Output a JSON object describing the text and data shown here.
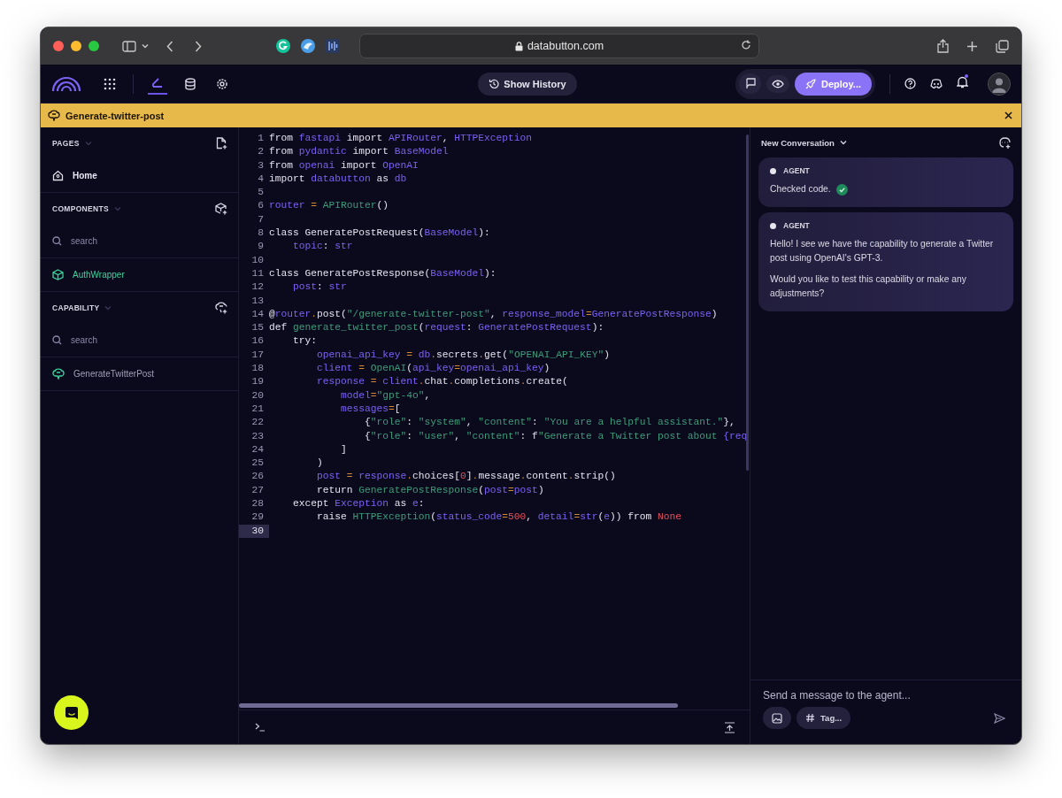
{
  "browser": {
    "url": "databutton.com"
  },
  "toolbar": {
    "nav_items": [
      {
        "kind": "apps",
        "selected": false
      },
      {
        "kind": "editor",
        "selected": true
      },
      {
        "kind": "database",
        "selected": false
      },
      {
        "kind": "settings",
        "selected": false
      }
    ],
    "history_button": "Show History",
    "deploy_button": "Deploy...",
    "notifications_unread": true
  },
  "banner": {
    "title": "Generate-twitter-post"
  },
  "sidebar": {
    "sections": [
      {
        "title": "PAGES",
        "kind": "pages",
        "items": [
          {
            "label": "Home",
            "kind": "page"
          }
        ]
      },
      {
        "title": "COMPONENTS",
        "kind": "components",
        "search_placeholder": "search",
        "items": [
          {
            "label": "AuthWrapper",
            "kind": "component"
          }
        ]
      },
      {
        "title": "CAPABILITY",
        "kind": "capability",
        "search_placeholder": "search",
        "items": [
          {
            "label": "GenerateTwitterPost",
            "kind": "capability"
          }
        ]
      }
    ]
  },
  "editor": {
    "lines": [
      {
        "n": "1",
        "selected": false,
        "t": [
          {
            "kind": "plain",
            "text": "from "
          },
          {
            "kind": "name",
            "text": "fastapi"
          },
          {
            "kind": "plain",
            "text": " import "
          },
          {
            "kind": "name",
            "text": "APIRouter"
          },
          {
            "kind": "plain",
            "text": ", "
          },
          {
            "kind": "name",
            "text": "HTTPException"
          }
        ]
      },
      {
        "n": "2",
        "selected": false,
        "t": [
          {
            "kind": "plain",
            "text": "from "
          },
          {
            "kind": "name",
            "text": "pydantic"
          },
          {
            "kind": "plain",
            "text": " import "
          },
          {
            "kind": "name",
            "text": "BaseModel"
          }
        ]
      },
      {
        "n": "3",
        "selected": false,
        "t": [
          {
            "kind": "plain",
            "text": "from "
          },
          {
            "kind": "name",
            "text": "openai"
          },
          {
            "kind": "plain",
            "text": " import "
          },
          {
            "kind": "name",
            "text": "OpenAI"
          }
        ]
      },
      {
        "n": "4",
        "selected": false,
        "t": [
          {
            "kind": "plain",
            "text": "import "
          },
          {
            "kind": "name",
            "text": "databutton"
          },
          {
            "kind": "plain",
            "text": " as "
          },
          {
            "kind": "name",
            "text": "db"
          }
        ]
      },
      {
        "n": "5",
        "selected": false
      },
      {
        "n": "6",
        "selected": false,
        "t": [
          {
            "kind": "name",
            "text": "router"
          },
          {
            "kind": "operator",
            "text": " = "
          },
          {
            "kind": "call",
            "text": "APIRouter"
          },
          {
            "kind": "plain",
            "text": "()"
          }
        ]
      },
      {
        "n": "7",
        "selected": false
      },
      {
        "n": "8",
        "selected": false,
        "t": [
          {
            "kind": "plain",
            "text": "class GeneratePostRequest("
          },
          {
            "kind": "name",
            "text": "BaseModel"
          },
          {
            "kind": "plain",
            "text": "):"
          }
        ]
      },
      {
        "n": "9",
        "selected": false,
        "t": [
          {
            "kind": "name",
            "text": "    topic"
          },
          {
            "kind": "plain",
            "text": ": "
          },
          {
            "kind": "name",
            "text": "str"
          }
        ]
      },
      {
        "n": "10",
        "selected": false
      },
      {
        "n": "11",
        "selected": false,
        "t": [
          {
            "kind": "plain",
            "text": "class GeneratePostResponse("
          },
          {
            "kind": "name",
            "text": "BaseModel"
          },
          {
            "kind": "plain",
            "text": "):"
          }
        ]
      },
      {
        "n": "12",
        "selected": false,
        "t": [
          {
            "kind": "name",
            "text": "    post"
          },
          {
            "kind": "plain",
            "text": ": "
          },
          {
            "kind": "name",
            "text": "str"
          }
        ]
      },
      {
        "n": "13",
        "selected": false
      },
      {
        "n": "14",
        "selected": false,
        "t": [
          {
            "kind": "plain",
            "text": "@"
          },
          {
            "kind": "name",
            "text": "router"
          },
          {
            "kind": "operator",
            "text": "."
          },
          {
            "kind": "plain",
            "text": "post("
          },
          {
            "kind": "string",
            "text": "\"/generate-twitter-post\""
          },
          {
            "kind": "plain",
            "text": ", "
          },
          {
            "kind": "name",
            "text": "response_model"
          },
          {
            "kind": "operator",
            "text": "="
          },
          {
            "kind": "name",
            "text": "GeneratePostResponse"
          },
          {
            "kind": "plain",
            "text": ")"
          }
        ]
      },
      {
        "n": "15",
        "selected": false,
        "t": [
          {
            "kind": "plain",
            "text": "def "
          },
          {
            "kind": "call",
            "text": "generate_twitter_post"
          },
          {
            "kind": "plain",
            "text": "("
          },
          {
            "kind": "name",
            "text": "request"
          },
          {
            "kind": "plain",
            "text": ": "
          },
          {
            "kind": "name",
            "text": "GeneratePostRequest"
          },
          {
            "kind": "plain",
            "text": "):"
          }
        ]
      },
      {
        "n": "16",
        "selected": false,
        "t": [
          {
            "kind": "plain",
            "text": "    try:"
          }
        ]
      },
      {
        "n": "17",
        "selected": false,
        "t": [
          {
            "kind": "name",
            "text": "        openai_api_key"
          },
          {
            "kind": "operator",
            "text": " = "
          },
          {
            "kind": "name",
            "text": "db"
          },
          {
            "kind": "operator",
            "text": "."
          },
          {
            "kind": "plain",
            "text": "secrets"
          },
          {
            "kind": "operator",
            "text": "."
          },
          {
            "kind": "plain",
            "text": "get("
          },
          {
            "kind": "string",
            "text": "\"OPENAI_API_KEY\""
          },
          {
            "kind": "plain",
            "text": ")"
          }
        ]
      },
      {
        "n": "18",
        "selected": false,
        "t": [
          {
            "kind": "name",
            "text": "        client"
          },
          {
            "kind": "operator",
            "text": " = "
          },
          {
            "kind": "call",
            "text": "OpenAI"
          },
          {
            "kind": "plain",
            "text": "("
          },
          {
            "kind": "name",
            "text": "api_key"
          },
          {
            "kind": "operator",
            "text": "="
          },
          {
            "kind": "name",
            "text": "openai_api_key"
          },
          {
            "kind": "plain",
            "text": ")"
          }
        ]
      },
      {
        "n": "19",
        "selected": false,
        "t": [
          {
            "kind": "name",
            "text": "        response"
          },
          {
            "kind": "operator",
            "text": " = "
          },
          {
            "kind": "name",
            "text": "client"
          },
          {
            "kind": "operator",
            "text": "."
          },
          {
            "kind": "plain",
            "text": "chat"
          },
          {
            "kind": "operator",
            "text": "."
          },
          {
            "kind": "plain",
            "text": "completions"
          },
          {
            "kind": "operator",
            "text": "."
          },
          {
            "kind": "plain",
            "text": "create("
          }
        ]
      },
      {
        "n": "20",
        "selected": false,
        "t": [
          {
            "kind": "name",
            "text": "            model"
          },
          {
            "kind": "operator",
            "text": "="
          },
          {
            "kind": "string",
            "text": "\"gpt-4o\""
          },
          {
            "kind": "plain",
            "text": ","
          }
        ]
      },
      {
        "n": "21",
        "selected": false,
        "t": [
          {
            "kind": "name",
            "text": "            messages"
          },
          {
            "kind": "operator",
            "text": "="
          },
          {
            "kind": "plain",
            "text": "["
          }
        ]
      },
      {
        "n": "22",
        "selected": false,
        "t": [
          {
            "kind": "plain",
            "text": "                {"
          },
          {
            "kind": "string",
            "text": "\"role\""
          },
          {
            "kind": "plain",
            "text": ": "
          },
          {
            "kind": "string",
            "text": "\"system\""
          },
          {
            "kind": "plain",
            "text": ", "
          },
          {
            "kind": "string",
            "text": "\"content\""
          },
          {
            "kind": "plain",
            "text": ": "
          },
          {
            "kind": "string",
            "text": "\"You are a helpful assistant.\""
          },
          {
            "kind": "plain",
            "text": "},"
          }
        ]
      },
      {
        "n": "23",
        "selected": false,
        "t": [
          {
            "kind": "plain",
            "text": "                {"
          },
          {
            "kind": "string",
            "text": "\"role\""
          },
          {
            "kind": "plain",
            "text": ": "
          },
          {
            "kind": "string",
            "text": "\"user\""
          },
          {
            "kind": "plain",
            "text": ", "
          },
          {
            "kind": "string",
            "text": "\"content\""
          },
          {
            "kind": "plain",
            "text": ": f"
          },
          {
            "kind": "string",
            "text": "\"Generate a Twitter post about "
          },
          {
            "kind": "name",
            "text": "{req"
          }
        ]
      },
      {
        "n": "24",
        "selected": false,
        "t": [
          {
            "kind": "plain",
            "text": "            ]"
          }
        ]
      },
      {
        "n": "25",
        "selected": false,
        "t": [
          {
            "kind": "plain",
            "text": "        )"
          }
        ]
      },
      {
        "n": "26",
        "selected": false,
        "t": [
          {
            "kind": "name",
            "text": "        post"
          },
          {
            "kind": "operator",
            "text": " = "
          },
          {
            "kind": "name",
            "text": "response"
          },
          {
            "kind": "operator",
            "text": "."
          },
          {
            "kind": "plain",
            "text": "choices["
          },
          {
            "kind": "constant",
            "text": "0"
          },
          {
            "kind": "plain",
            "text": "]"
          },
          {
            "kind": "operator",
            "text": "."
          },
          {
            "kind": "plain",
            "text": "message"
          },
          {
            "kind": "operator",
            "text": "."
          },
          {
            "kind": "plain",
            "text": "content"
          },
          {
            "kind": "operator",
            "text": "."
          },
          {
            "kind": "plain",
            "text": "strip()"
          }
        ]
      },
      {
        "n": "27",
        "selected": false,
        "t": [
          {
            "kind": "plain",
            "text": "        return "
          },
          {
            "kind": "call",
            "text": "GeneratePostResponse"
          },
          {
            "kind": "plain",
            "text": "("
          },
          {
            "kind": "name",
            "text": "post"
          },
          {
            "kind": "operator",
            "text": "="
          },
          {
            "kind": "name",
            "text": "post"
          },
          {
            "kind": "plain",
            "text": ")"
          }
        ]
      },
      {
        "n": "28",
        "selected": false,
        "t": [
          {
            "kind": "plain",
            "text": "    except "
          },
          {
            "kind": "name",
            "text": "Exception"
          },
          {
            "kind": "plain",
            "text": " as "
          },
          {
            "kind": "name",
            "text": "e"
          },
          {
            "kind": "plain",
            "text": ":"
          }
        ]
      },
      {
        "n": "29",
        "selected": false,
        "t": [
          {
            "kind": "plain",
            "text": "        raise "
          },
          {
            "kind": "call",
            "text": "HTTPException"
          },
          {
            "kind": "plain",
            "text": "("
          },
          {
            "kind": "name",
            "text": "status_code"
          },
          {
            "kind": "operator",
            "text": "="
          },
          {
            "kind": "constant",
            "text": "500"
          },
          {
            "kind": "plain",
            "text": ", "
          },
          {
            "kind": "name",
            "text": "detail"
          },
          {
            "kind": "operator",
            "text": "="
          },
          {
            "kind": "name",
            "text": "str"
          },
          {
            "kind": "plain",
            "text": "("
          },
          {
            "kind": "name",
            "text": "e"
          },
          {
            "kind": "plain",
            "text": ")) from "
          },
          {
            "kind": "constant",
            "text": "None"
          }
        ]
      },
      {
        "n": "30",
        "selected": true
      }
    ]
  },
  "chat": {
    "title": "New Conversation",
    "messages": [
      {
        "author": "AGENT",
        "checked": true,
        "paragraphs": [
          "Checked code."
        ]
      },
      {
        "author": "AGENT",
        "checked": false,
        "paragraphs": [
          "Hello! I see we have the capability to generate a Twitter post using OpenAI's GPT-3.",
          "Would you like to test this capability or make any adjustments?"
        ]
      }
    ],
    "input_placeholder": "Send a message to the agent...",
    "tag_button": "Tag..."
  }
}
